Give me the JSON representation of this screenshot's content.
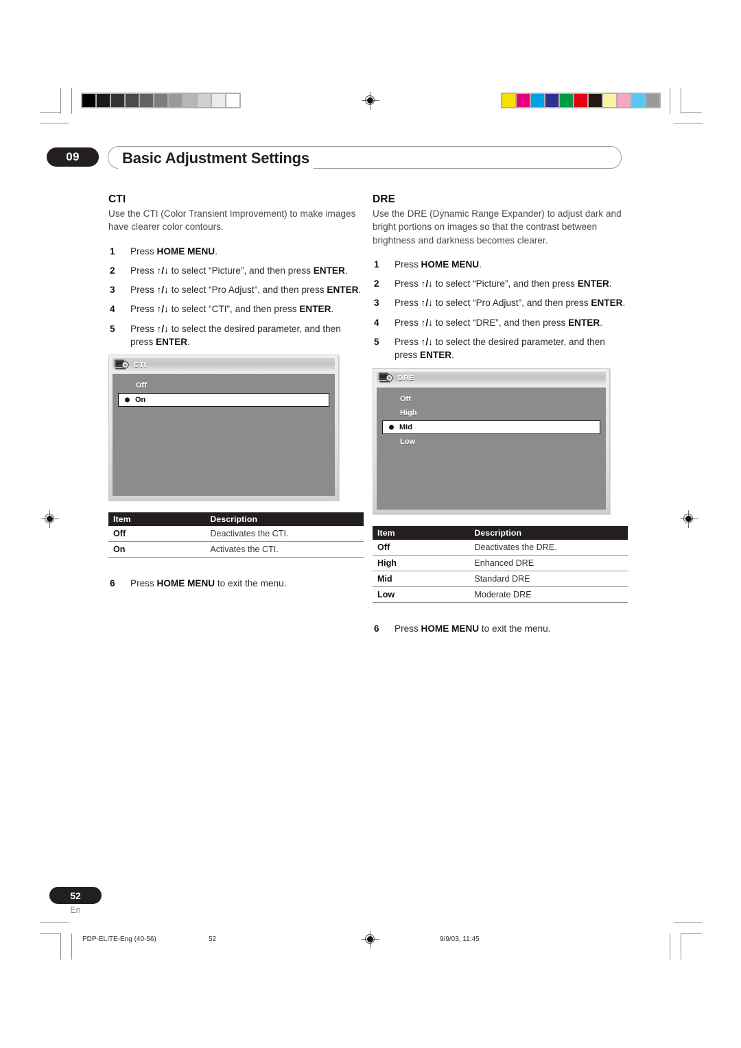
{
  "document": {
    "chapter_number": "09",
    "chapter_title": "Basic Adjustment Settings",
    "page_number": "52",
    "language_code": "En"
  },
  "print_marks": {
    "file_label": "PDP-ELITE-Eng (40-56)",
    "footer_page": "52",
    "timestamp": "9/9/03, 11:45",
    "gray_swatches": [
      "#000000",
      "#1c1c1c",
      "#333333",
      "#4b4b4b",
      "#626262",
      "#7d7d7d",
      "#9a9a9a",
      "#b6b6b6",
      "#d0d0d0",
      "#ebebeb",
      "#ffffff"
    ],
    "color_swatches": [
      "#f5e000",
      "#e5007d",
      "#00a0e9",
      "#2e3192",
      "#009944",
      "#e60012",
      "#231815",
      "#fbf2a0",
      "#f4a6c3",
      "#59c8f0",
      "#9a9a9a"
    ]
  },
  "sections": [
    {
      "id": "cti",
      "title": "CTI",
      "lede": "Use the CTI (Color Transient Improvement) to make images have clearer color contours.",
      "steps": [
        {
          "num": "1",
          "parts": [
            {
              "t": "Press ",
              "b": false
            },
            {
              "t": "HOME MENU",
              "b": true
            },
            {
              "t": ".",
              "b": false
            }
          ]
        },
        {
          "num": "2",
          "parts": [
            {
              "t": "Press ",
              "b": false
            },
            {
              "t": "↑/↓",
              "b": true
            },
            {
              "t": " to select “Picture”, and then press ",
              "b": false
            },
            {
              "t": "ENTER",
              "b": true
            },
            {
              "t": ".",
              "b": false
            }
          ]
        },
        {
          "num": "3",
          "parts": [
            {
              "t": "Press ",
              "b": false
            },
            {
              "t": "↑/↓",
              "b": true
            },
            {
              "t": " to select “Pro Adjust”, and then press ",
              "b": false
            },
            {
              "t": "ENTER",
              "b": true
            },
            {
              "t": ".",
              "b": false
            }
          ]
        },
        {
          "num": "4",
          "parts": [
            {
              "t": "Press ",
              "b": false
            },
            {
              "t": "↑/↓",
              "b": true
            },
            {
              "t": " to select “CTI”, and then press ",
              "b": false
            },
            {
              "t": "ENTER",
              "b": true
            },
            {
              "t": ".",
              "b": false
            }
          ]
        },
        {
          "num": "5",
          "parts": [
            {
              "t": "Press ",
              "b": false
            },
            {
              "t": "↑/↓",
              "b": true
            },
            {
              "t": " to select the desired parameter, and then press ",
              "b": false
            },
            {
              "t": "ENTER",
              "b": true
            },
            {
              "t": ".",
              "b": false
            }
          ]
        }
      ],
      "osd": {
        "title": "CTI",
        "icon": "tv-gear-icon",
        "options": [
          {
            "label": "Off",
            "selected": false
          },
          {
            "label": "On",
            "selected": true
          }
        ]
      },
      "table": {
        "headers": [
          "Item",
          "Description"
        ],
        "rows": [
          [
            "Off",
            "Deactivates the CTI."
          ],
          [
            "On",
            "Activates the CTI."
          ]
        ]
      },
      "final_step": {
        "num": "6",
        "parts": [
          {
            "t": "Press ",
            "b": false
          },
          {
            "t": "HOME MENU",
            "b": true
          },
          {
            "t": " to exit the menu.",
            "b": false
          }
        ]
      }
    },
    {
      "id": "dre",
      "title": "DRE",
      "lede": "Use the DRE (Dynamic Range Expander) to adjust dark and bright portions on images so that the contrast between brightness and darkness becomes clearer.",
      "steps": [
        {
          "num": "1",
          "parts": [
            {
              "t": "Press ",
              "b": false
            },
            {
              "t": "HOME MENU",
              "b": true
            },
            {
              "t": ".",
              "b": false
            }
          ]
        },
        {
          "num": "2",
          "parts": [
            {
              "t": "Press ",
              "b": false
            },
            {
              "t": "↑/↓",
              "b": true
            },
            {
              "t": " to select “Picture”, and then press ",
              "b": false
            },
            {
              "t": "ENTER",
              "b": true
            },
            {
              "t": ".",
              "b": false
            }
          ]
        },
        {
          "num": "3",
          "parts": [
            {
              "t": "Press ",
              "b": false
            },
            {
              "t": "↑/↓",
              "b": true
            },
            {
              "t": " to select “Pro Adjust”, and then press ",
              "b": false
            },
            {
              "t": "ENTER",
              "b": true
            },
            {
              "t": ".",
              "b": false
            }
          ]
        },
        {
          "num": "4",
          "parts": [
            {
              "t": "Press ",
              "b": false
            },
            {
              "t": "↑/↓",
              "b": true
            },
            {
              "t": " to select “DRE”, and then press ",
              "b": false
            },
            {
              "t": "ENTER",
              "b": true
            },
            {
              "t": ".",
              "b": false
            }
          ]
        },
        {
          "num": "5",
          "parts": [
            {
              "t": "Press ",
              "b": false
            },
            {
              "t": "↑/↓",
              "b": true
            },
            {
              "t": " to select the desired parameter, and then press ",
              "b": false
            },
            {
              "t": "ENTER",
              "b": true
            },
            {
              "t": ".",
              "b": false
            }
          ]
        }
      ],
      "osd": {
        "title": "DRE",
        "icon": "tv-gear-icon",
        "options": [
          {
            "label": "Off",
            "selected": false
          },
          {
            "label": "High",
            "selected": false
          },
          {
            "label": "Mid",
            "selected": true
          },
          {
            "label": "Low",
            "selected": false
          }
        ]
      },
      "table": {
        "headers": [
          "Item",
          "Description"
        ],
        "rows": [
          [
            "Off",
            "Deactivates the DRE."
          ],
          [
            "High",
            "Enhanced DRE"
          ],
          [
            "Mid",
            "Standard DRE"
          ],
          [
            "Low",
            "Moderate DRE"
          ]
        ]
      },
      "final_step": {
        "num": "6",
        "parts": [
          {
            "t": "Press ",
            "b": false
          },
          {
            "t": "HOME MENU",
            "b": true
          },
          {
            "t": " to exit the menu.",
            "b": false
          }
        ]
      }
    }
  ]
}
